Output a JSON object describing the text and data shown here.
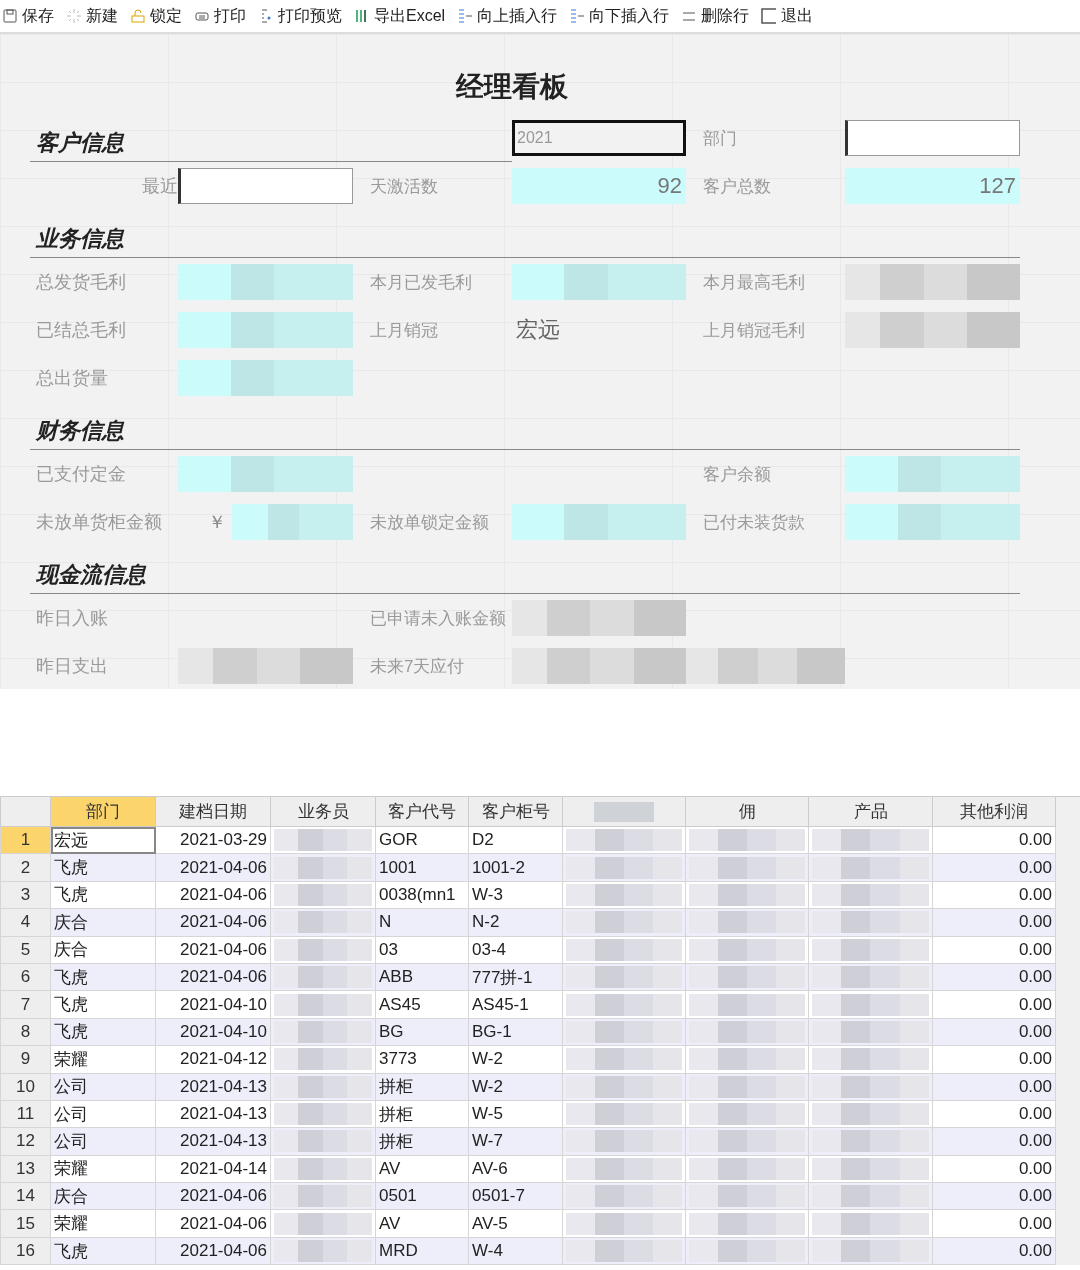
{
  "toolbar": [
    {
      "label": "保存"
    },
    {
      "label": "新建"
    },
    {
      "label": "锁定"
    },
    {
      "label": "打印"
    },
    {
      "label": "打印预览"
    },
    {
      "label": "导出Excel"
    },
    {
      "label": "向上插入行"
    },
    {
      "label": "向下插入行"
    },
    {
      "label": "删除行"
    },
    {
      "label": "退出"
    }
  ],
  "form": {
    "title": "经理看板",
    "rows": [
      {
        "cells": [
          {
            "kind": "heading",
            "text": "客户信息"
          },
          {
            "kind": "empty"
          },
          {
            "kind": "empty"
          },
          {
            "kind": "field",
            "value": "2021",
            "selected": true
          },
          {
            "kind": "label",
            "text": "部门"
          },
          {
            "kind": "field",
            "selected": false
          }
        ]
      },
      {
        "cells": [
          {
            "kind": "label",
            "text": "最近"
          },
          {
            "kind": "field",
            "selected": false
          },
          {
            "kind": "label",
            "text": "天激活数"
          },
          {
            "kind": "value",
            "text": "92"
          },
          {
            "kind": "label",
            "text": "客户总数"
          },
          {
            "kind": "value",
            "text": "127"
          }
        ]
      },
      {
        "cells": [
          {
            "kind": "heading",
            "text": "业务信息"
          }
        ]
      },
      {
        "cells": [
          {
            "kind": "label",
            "text": "总发货毛利"
          },
          {
            "kind": "masked"
          },
          {
            "kind": "label",
            "text": "本月已发毛利"
          },
          {
            "kind": "masked"
          },
          {
            "kind": "label",
            "text": "本月最高毛利"
          },
          {
            "kind": "masked-plain"
          }
        ]
      },
      {
        "cells": [
          {
            "kind": "label",
            "text": "已结总毛利"
          },
          {
            "kind": "masked"
          },
          {
            "kind": "label",
            "text": "上月销冠"
          },
          {
            "kind": "text",
            "text": "宏远"
          },
          {
            "kind": "label",
            "text": "上月销冠毛利"
          },
          {
            "kind": "masked-plain"
          }
        ]
      },
      {
        "cells": [
          {
            "kind": "label",
            "text": "总出货量"
          },
          {
            "kind": "masked"
          }
        ]
      },
      {
        "cells": [
          {
            "kind": "heading",
            "text": "财务信息"
          }
        ]
      },
      {
        "cells": [
          {
            "kind": "label",
            "text": "已支付定金"
          },
          {
            "kind": "masked"
          },
          {
            "kind": "empty"
          },
          {
            "kind": "empty"
          },
          {
            "kind": "label",
            "text": "客户余额"
          },
          {
            "kind": "masked"
          }
        ]
      },
      {
        "cells": [
          {
            "kind": "label",
            "text": "未放单货柜金额"
          },
          {
            "kind": "masked",
            "prefix": "￥"
          },
          {
            "kind": "label",
            "text": "未放单锁定金额"
          },
          {
            "kind": "masked"
          },
          {
            "kind": "label",
            "text": "已付未装货款"
          },
          {
            "kind": "masked"
          }
        ]
      },
      {
        "cells": [
          {
            "kind": "heading",
            "text": "现金流信息"
          }
        ]
      },
      {
        "cells": [
          {
            "kind": "label",
            "text": "昨日入账"
          },
          {
            "kind": "empty"
          },
          {
            "kind": "label",
            "text": "已申请未入账金额"
          },
          {
            "kind": "masked-plain"
          }
        ]
      },
      {
        "cells": [
          {
            "kind": "label",
            "text": "昨日支出"
          },
          {
            "kind": "masked-plain"
          },
          {
            "kind": "label",
            "text": "未来7天应付"
          },
          {
            "kind": "masked-plain"
          },
          {
            "kind": "masked-plain"
          }
        ]
      }
    ]
  },
  "table": {
    "columns": [
      {
        "label": "部门",
        "kind": "text",
        "selected": true
      },
      {
        "label": "建档日期",
        "kind": "date",
        "selected": false
      },
      {
        "label": "业务员",
        "kind": "masked",
        "selected": false
      },
      {
        "label": "客户代号",
        "kind": "text",
        "selected": false
      },
      {
        "label": "客户柜号",
        "kind": "text",
        "selected": false
      },
      {
        "kind": "masked",
        "selected": false
      },
      {
        "label": "佣",
        "kind": "masked",
        "selected": false
      },
      {
        "label": "产品",
        "kind": "masked",
        "selected": false
      },
      {
        "label": "其他利润",
        "kind": "number",
        "selected": false
      }
    ],
    "rows": [
      {
        "num": "1",
        "dept": "宏远",
        "date": "2021-03-29",
        "code": "GOR",
        "cabinet": "D2",
        "other": "0.00",
        "selected": true
      },
      {
        "num": "2",
        "dept": "飞虎",
        "date": "2021-04-06",
        "code": "1001",
        "cabinet": "1001-2",
        "other": "0.00",
        "selected": false
      },
      {
        "num": "3",
        "dept": "飞虎",
        "date": "2021-04-06",
        "code": "0038(mn1",
        "cabinet": "W-3",
        "other": "0.00",
        "selected": false
      },
      {
        "num": "4",
        "dept": "庆合",
        "date": "2021-04-06",
        "code": "N",
        "cabinet": "N-2",
        "other": "0.00",
        "selected": false
      },
      {
        "num": "5",
        "dept": "庆合",
        "date": "2021-04-06",
        "code": "03",
        "cabinet": "03-4",
        "other": "0.00",
        "selected": false
      },
      {
        "num": "6",
        "dept": "飞虎",
        "date": "2021-04-06",
        "code": "ABB",
        "cabinet": "777拼-1",
        "other": "0.00",
        "selected": false
      },
      {
        "num": "7",
        "dept": "飞虎",
        "date": "2021-04-10",
        "code": "AS45",
        "cabinet": "AS45-1",
        "other": "0.00",
        "selected": false
      },
      {
        "num": "8",
        "dept": "飞虎",
        "date": "2021-04-10",
        "code": "BG",
        "cabinet": "BG-1",
        "other": "0.00",
        "selected": false
      },
      {
        "num": "9",
        "dept": "荣耀",
        "date": "2021-04-12",
        "code": "3773",
        "cabinet": "W-2",
        "other": "0.00",
        "selected": false
      },
      {
        "num": "10",
        "dept": "公司",
        "date": "2021-04-13",
        "code": "拼柜",
        "cabinet": "W-2",
        "other": "0.00",
        "selected": false
      },
      {
        "num": "11",
        "dept": "公司",
        "date": "2021-04-13",
        "code": "拼柜",
        "cabinet": "W-5",
        "other": "0.00",
        "selected": false
      },
      {
        "num": "12",
        "dept": "公司",
        "date": "2021-04-13",
        "code": "拼柜",
        "cabinet": "W-7",
        "other": "0.00",
        "selected": false
      },
      {
        "num": "13",
        "dept": "荣耀",
        "date": "2021-04-14",
        "code": "AV",
        "cabinet": "AV-6",
        "other": "0.00",
        "selected": false
      },
      {
        "num": "14",
        "dept": "庆合",
        "date": "2021-04-06",
        "code": "0501",
        "cabinet": "0501-7",
        "other": "0.00",
        "selected": false
      },
      {
        "num": "15",
        "dept": "荣耀",
        "date": "2021-04-06",
        "code": "AV",
        "cabinet": "AV-5",
        "other": "0.00",
        "selected": false
      },
      {
        "num": "16",
        "dept": "飞虎",
        "date": "2021-04-06",
        "code": "MRD",
        "cabinet": "W-4",
        "other": "0.00",
        "selected": false
      }
    ]
  }
}
